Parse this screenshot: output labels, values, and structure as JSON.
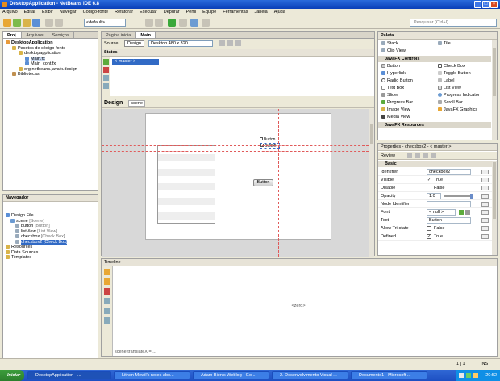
{
  "window": {
    "title": "DesktopApplication - NetBeans IDE 6.8"
  },
  "menu": [
    "Arquivo",
    "Editar",
    "Exibir",
    "Navegar",
    "Código-fonte",
    "Refatorar",
    "Executar",
    "Depurar",
    "Perfil",
    "Equipe",
    "Ferramentas",
    "Janela",
    "Ajuda"
  ],
  "toolbar": {
    "config": "<default>",
    "search_placeholder": "Pesquisar (Ctrl+I)"
  },
  "projects": {
    "tabs": [
      "Proj.",
      "Arquivos",
      "Serviços"
    ],
    "tree": [
      "DesktopApplication",
      "Pacotes de código-fonte",
      "desktopapplication",
      "Main.fx",
      "Main_cont.fx",
      "org.netbeans.javafx.design",
      "Bibliotecas"
    ]
  },
  "navigator": {
    "title": "Navegador",
    "items": [
      {
        "label": "Design File",
        "hint": ""
      },
      {
        "label": "scene",
        "hint": "[Scene]"
      },
      {
        "label": "button",
        "hint": "[Button]"
      },
      {
        "label": "listView",
        "hint": "[List View]"
      },
      {
        "label": "checkbox",
        "hint": "[Check Box]"
      },
      {
        "label": "checkbox2",
        "hint": "[Check Box]"
      },
      {
        "label": "Resources",
        "hint": ""
      },
      {
        "label": "Data Sources",
        "hint": ""
      },
      {
        "label": "Templates",
        "hint": ""
      }
    ]
  },
  "editor": {
    "tabs": [
      "Página inicial",
      "Main"
    ],
    "view_source": "Source",
    "view_design": "Design",
    "device": "Desktop 480 x 320",
    "states_label": "States",
    "master_state": "< master >",
    "design_label": "Design",
    "scene_label": "scene",
    "button_label": "Button",
    "cb_label": "Button",
    "cb2_label": "Button"
  },
  "palette": {
    "title": "Paleta",
    "items": [
      "Stack",
      "Tile",
      "Clip View",
      "Button",
      "Check Box",
      "Hyperlink",
      "Toggle Button",
      "Radio Button",
      "Label",
      "Text Box",
      "List View",
      "Slider",
      "Progress Indicator",
      "Progress Bar",
      "Scroll Bar",
      "Image View",
      "JavaFX Graphics",
      "Media View"
    ],
    "sections": [
      "JavaFX Controls",
      "JavaFX Resources"
    ]
  },
  "properties": {
    "title": "Properties - checkbox2 - < master >",
    "tab": "Review",
    "section": "Basic",
    "rows": [
      {
        "name": "Identifier",
        "value": "checkbox2"
      },
      {
        "name": "Visible",
        "value": "True"
      },
      {
        "name": "Disable",
        "value": "False"
      },
      {
        "name": "Opacity",
        "value": "1.0"
      },
      {
        "name": "Node Identifier",
        "value": ""
      },
      {
        "name": "Font",
        "value": "< null >"
      },
      {
        "name": "Text",
        "value": "Button"
      },
      {
        "name": "Allow Tri-state",
        "value": "False"
      },
      {
        "name": "Defined",
        "value": "True"
      }
    ]
  },
  "timeline": {
    "title": "Timeline",
    "center_text": "<zero>",
    "bottom_text": "scene.translateX = ..."
  },
  "status": {
    "pos": "1 | 1",
    "ins": "INS"
  },
  "taskbar": {
    "start": "Iniciar",
    "tasks": [
      "DesktopApplication - ...",
      "Lithen Mewil's notes abo...",
      "Adam Bien's Weblog - Go...",
      "2. Desenvolvimento Visual ...",
      "Documento1 - Microsoft ..."
    ],
    "clock": "20:52"
  }
}
